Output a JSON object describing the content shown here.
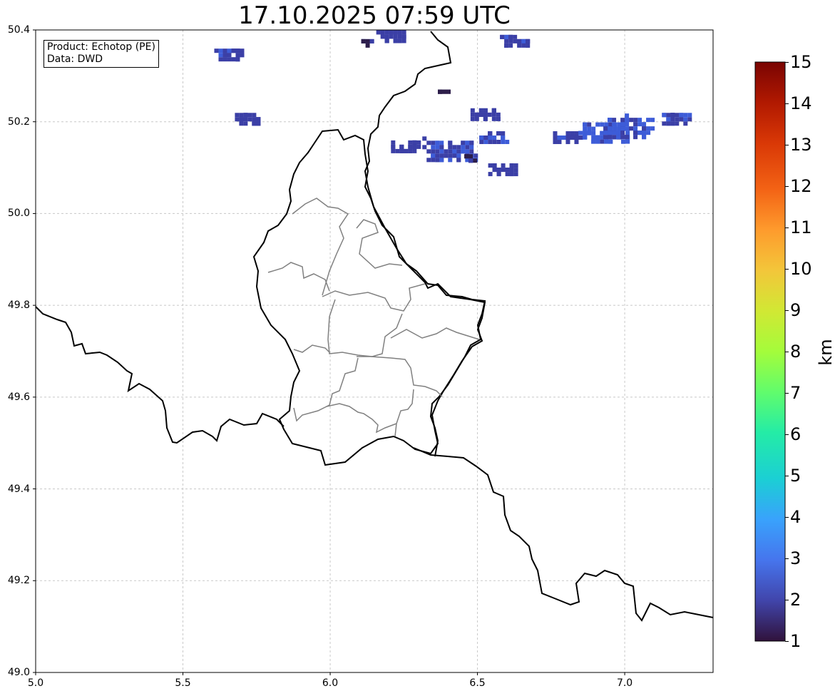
{
  "title": "17.10.2025 07:59 UTC",
  "info_box": {
    "product": "Product: Echotop (PE)",
    "data": "Data: DWD"
  },
  "axes": {
    "x_ticks": [
      "5.0",
      "5.5",
      "6.0",
      "6.5",
      "7.0"
    ],
    "y_ticks": [
      "50.4",
      "50.2",
      "50.0",
      "49.8",
      "49.6",
      "49.4",
      "49.2",
      "49.0"
    ],
    "xlim": [
      5.0,
      7.3
    ],
    "ylim": [
      49.0,
      50.4
    ],
    "grid": true
  },
  "colorbar": {
    "label": "km",
    "ticks": [
      "15",
      "14",
      "13",
      "12",
      "11",
      "10",
      "9",
      "8",
      "7",
      "6",
      "5",
      "4",
      "3",
      "2",
      "1"
    ],
    "range": [
      1,
      15
    ],
    "colormap": "turbo"
  },
  "colors": {
    "border_national": "#000000",
    "border_canton": "#808080",
    "grid": "#c8c8c8",
    "echo_low": "#2d1e4a",
    "echo_mid": "#3b3fa6",
    "echo_high": "#3d5cd8"
  },
  "echo_cells": [
    {
      "lon": 5.65,
      "lat": 50.35,
      "km": 2.2
    },
    {
      "lon": 5.72,
      "lat": 50.21,
      "km": 2.0
    },
    {
      "lon": 6.12,
      "lat": 50.38,
      "km": 1.8
    },
    {
      "lon": 6.2,
      "lat": 50.39,
      "km": 2.0
    },
    {
      "lon": 6.62,
      "lat": 50.38,
      "km": 2.1
    },
    {
      "lon": 6.38,
      "lat": 50.27,
      "km": 1.3
    },
    {
      "lon": 6.52,
      "lat": 50.22,
      "km": 2.0
    },
    {
      "lon": 6.25,
      "lat": 50.15,
      "km": 2.1
    },
    {
      "lon": 6.4,
      "lat": 50.14,
      "km": 2.3
    },
    {
      "lon": 6.47,
      "lat": 50.12,
      "km": 1.6
    },
    {
      "lon": 6.55,
      "lat": 50.17,
      "km": 2.2
    },
    {
      "lon": 6.58,
      "lat": 50.1,
      "km": 2.0
    },
    {
      "lon": 6.8,
      "lat": 50.17,
      "km": 2.2
    },
    {
      "lon": 6.93,
      "lat": 50.18,
      "km": 2.6
    },
    {
      "lon": 7.0,
      "lat": 50.19,
      "km": 2.4
    },
    {
      "lon": 7.17,
      "lat": 50.21,
      "km": 2.2
    }
  ]
}
